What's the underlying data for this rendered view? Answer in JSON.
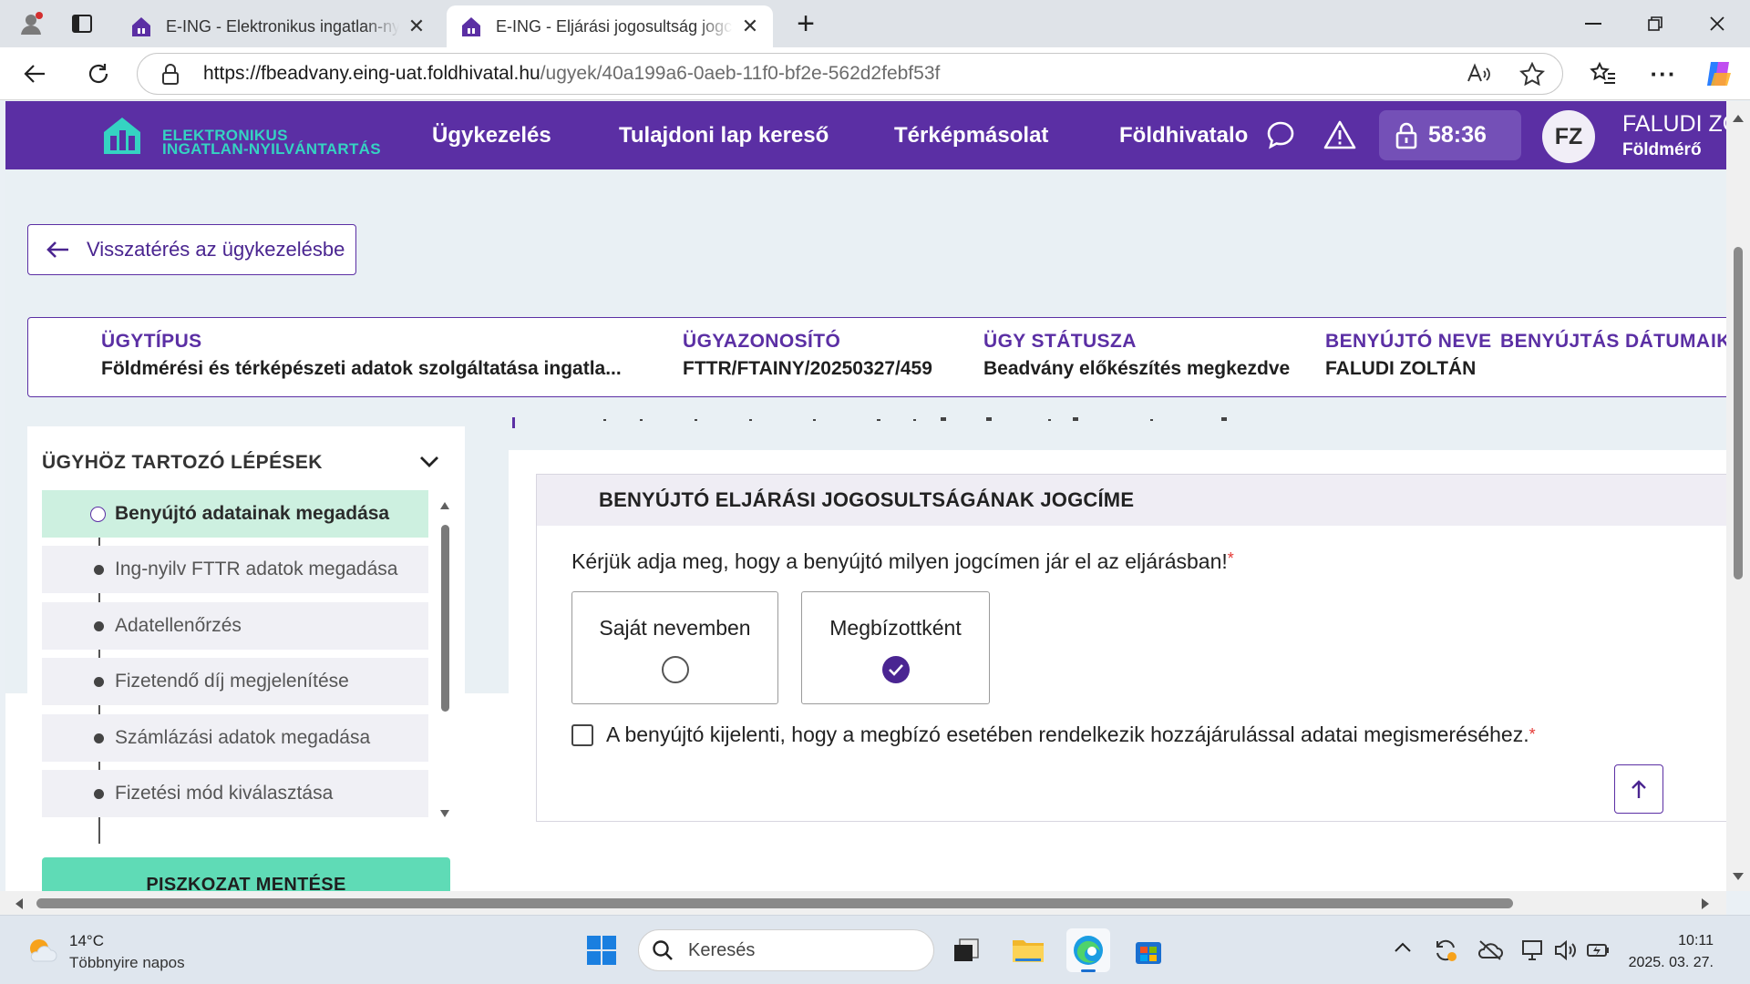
{
  "browser": {
    "tabs": [
      {
        "title": "E-ING - Elektronikus ingatlan-nyilvántartás",
        "active": false
      },
      {
        "title": "E-ING - Eljárási jogosultság jogcíme",
        "active": true
      }
    ],
    "url_host": "https://fbeadvany.eing-uat.foldhivatal.hu",
    "url_path": "/ugyek/40a199a6-0aeb-11f0-bf2e-562d2febf53f",
    "close_glyph": "✕",
    "new_tab_glyph": "+"
  },
  "header": {
    "logo_line1": "ELEKTRONIKUS",
    "logo_line2": "INGATLAN-NYILVÁNTARTÁS",
    "nav": [
      "Ügykezelés",
      "Tulajdoni lap kereső",
      "Térképmásolat",
      "Földhivatalo"
    ],
    "timer": "58:36",
    "avatar_initials": "FZ",
    "user_name": "FALUDI ZO",
    "user_role": "Földmérő",
    "brand_color": "#5b2fa4"
  },
  "back_button": "Visszatérés az ügykezelésbe",
  "summary": [
    {
      "label": "ÜGYTÍPUS",
      "value": "Földmérési és térképészeti adatok szolgáltatása ingatla..."
    },
    {
      "label": "ÜGYAZONOSÍTÓ",
      "value": "FTTR/FTAINY/20250327/459"
    },
    {
      "label": "ÜGY STÁTUSZA",
      "value": "Beadvány előkészítés megkezdve"
    },
    {
      "label": "BENYÚJTÓ NEVE",
      "value": "FALUDI ZOLTÁN"
    },
    {
      "label": "BENYÚJTÁS DÁTUMA",
      "value": ""
    },
    {
      "label": "IK",
      "value": ""
    }
  ],
  "steps": {
    "title": "ÜGYHÖZ TARTOZÓ LÉPÉSEK",
    "items": [
      {
        "label": "Benyújtó adatainak megadása",
        "active": true
      },
      {
        "label": "Ing-nyilv FTTR adatok megadása",
        "active": false
      },
      {
        "label": "Adatellenőrzés",
        "active": false
      },
      {
        "label": "Fizetendő díj megjelenítése",
        "active": false
      },
      {
        "label": "Számlázási adatok megadása",
        "active": false
      },
      {
        "label": "Fizetési mód kiválasztása",
        "active": false
      }
    ],
    "save_label": "PISZKOZAT MENTÉSE"
  },
  "form": {
    "heading": "BENYÚJTÓ ELJÁRÁSI JOGOSULTSÁGÁNAK JOGCÍME",
    "question": "Kérjük adja meg, hogy a benyújtó milyen jogcímen jár el az eljárásban!",
    "required_mark": "*",
    "options": [
      {
        "label": "Saját nevemben",
        "selected": false
      },
      {
        "label": "Megbízottként",
        "selected": true
      }
    ],
    "consent_label": "A benyújtó kijelenti, hogy a megbízó esetében rendelkezik hozzájárulással adatai megismeréséhez.",
    "consent_checked": false
  },
  "taskbar": {
    "temperature": "14°C",
    "weather": "Többnyire napos",
    "search_placeholder": "Keresés",
    "time": "10:11",
    "date": "2025. 03. 27."
  }
}
